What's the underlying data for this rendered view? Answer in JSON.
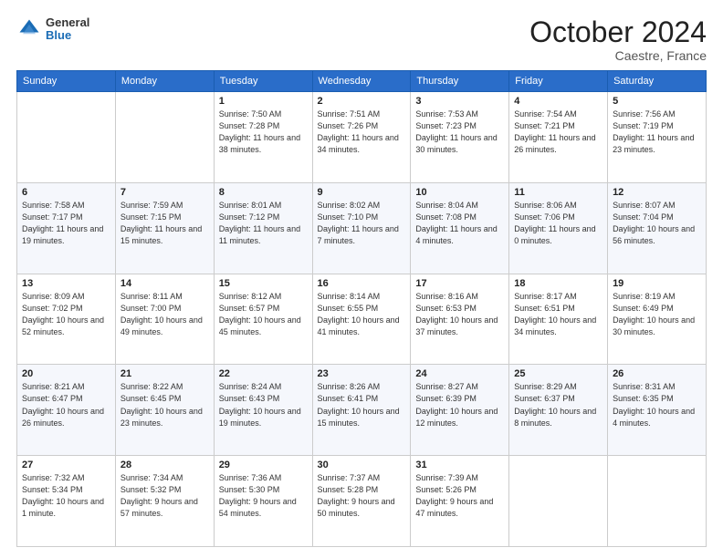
{
  "header": {
    "logo_general": "General",
    "logo_blue": "Blue",
    "month": "October 2024",
    "location": "Caestre, France"
  },
  "weekdays": [
    "Sunday",
    "Monday",
    "Tuesday",
    "Wednesday",
    "Thursday",
    "Friday",
    "Saturday"
  ],
  "weeks": [
    [
      {
        "day": "",
        "sunrise": "",
        "sunset": "",
        "daylight": ""
      },
      {
        "day": "",
        "sunrise": "",
        "sunset": "",
        "daylight": ""
      },
      {
        "day": "1",
        "sunrise": "Sunrise: 7:50 AM",
        "sunset": "Sunset: 7:28 PM",
        "daylight": "Daylight: 11 hours and 38 minutes."
      },
      {
        "day": "2",
        "sunrise": "Sunrise: 7:51 AM",
        "sunset": "Sunset: 7:26 PM",
        "daylight": "Daylight: 11 hours and 34 minutes."
      },
      {
        "day": "3",
        "sunrise": "Sunrise: 7:53 AM",
        "sunset": "Sunset: 7:23 PM",
        "daylight": "Daylight: 11 hours and 30 minutes."
      },
      {
        "day": "4",
        "sunrise": "Sunrise: 7:54 AM",
        "sunset": "Sunset: 7:21 PM",
        "daylight": "Daylight: 11 hours and 26 minutes."
      },
      {
        "day": "5",
        "sunrise": "Sunrise: 7:56 AM",
        "sunset": "Sunset: 7:19 PM",
        "daylight": "Daylight: 11 hours and 23 minutes."
      }
    ],
    [
      {
        "day": "6",
        "sunrise": "Sunrise: 7:58 AM",
        "sunset": "Sunset: 7:17 PM",
        "daylight": "Daylight: 11 hours and 19 minutes."
      },
      {
        "day": "7",
        "sunrise": "Sunrise: 7:59 AM",
        "sunset": "Sunset: 7:15 PM",
        "daylight": "Daylight: 11 hours and 15 minutes."
      },
      {
        "day": "8",
        "sunrise": "Sunrise: 8:01 AM",
        "sunset": "Sunset: 7:12 PM",
        "daylight": "Daylight: 11 hours and 11 minutes."
      },
      {
        "day": "9",
        "sunrise": "Sunrise: 8:02 AM",
        "sunset": "Sunset: 7:10 PM",
        "daylight": "Daylight: 11 hours and 7 minutes."
      },
      {
        "day": "10",
        "sunrise": "Sunrise: 8:04 AM",
        "sunset": "Sunset: 7:08 PM",
        "daylight": "Daylight: 11 hours and 4 minutes."
      },
      {
        "day": "11",
        "sunrise": "Sunrise: 8:06 AM",
        "sunset": "Sunset: 7:06 PM",
        "daylight": "Daylight: 11 hours and 0 minutes."
      },
      {
        "day": "12",
        "sunrise": "Sunrise: 8:07 AM",
        "sunset": "Sunset: 7:04 PM",
        "daylight": "Daylight: 10 hours and 56 minutes."
      }
    ],
    [
      {
        "day": "13",
        "sunrise": "Sunrise: 8:09 AM",
        "sunset": "Sunset: 7:02 PM",
        "daylight": "Daylight: 10 hours and 52 minutes."
      },
      {
        "day": "14",
        "sunrise": "Sunrise: 8:11 AM",
        "sunset": "Sunset: 7:00 PM",
        "daylight": "Daylight: 10 hours and 49 minutes."
      },
      {
        "day": "15",
        "sunrise": "Sunrise: 8:12 AM",
        "sunset": "Sunset: 6:57 PM",
        "daylight": "Daylight: 10 hours and 45 minutes."
      },
      {
        "day": "16",
        "sunrise": "Sunrise: 8:14 AM",
        "sunset": "Sunset: 6:55 PM",
        "daylight": "Daylight: 10 hours and 41 minutes."
      },
      {
        "day": "17",
        "sunrise": "Sunrise: 8:16 AM",
        "sunset": "Sunset: 6:53 PM",
        "daylight": "Daylight: 10 hours and 37 minutes."
      },
      {
        "day": "18",
        "sunrise": "Sunrise: 8:17 AM",
        "sunset": "Sunset: 6:51 PM",
        "daylight": "Daylight: 10 hours and 34 minutes."
      },
      {
        "day": "19",
        "sunrise": "Sunrise: 8:19 AM",
        "sunset": "Sunset: 6:49 PM",
        "daylight": "Daylight: 10 hours and 30 minutes."
      }
    ],
    [
      {
        "day": "20",
        "sunrise": "Sunrise: 8:21 AM",
        "sunset": "Sunset: 6:47 PM",
        "daylight": "Daylight: 10 hours and 26 minutes."
      },
      {
        "day": "21",
        "sunrise": "Sunrise: 8:22 AM",
        "sunset": "Sunset: 6:45 PM",
        "daylight": "Daylight: 10 hours and 23 minutes."
      },
      {
        "day": "22",
        "sunrise": "Sunrise: 8:24 AM",
        "sunset": "Sunset: 6:43 PM",
        "daylight": "Daylight: 10 hours and 19 minutes."
      },
      {
        "day": "23",
        "sunrise": "Sunrise: 8:26 AM",
        "sunset": "Sunset: 6:41 PM",
        "daylight": "Daylight: 10 hours and 15 minutes."
      },
      {
        "day": "24",
        "sunrise": "Sunrise: 8:27 AM",
        "sunset": "Sunset: 6:39 PM",
        "daylight": "Daylight: 10 hours and 12 minutes."
      },
      {
        "day": "25",
        "sunrise": "Sunrise: 8:29 AM",
        "sunset": "Sunset: 6:37 PM",
        "daylight": "Daylight: 10 hours and 8 minutes."
      },
      {
        "day": "26",
        "sunrise": "Sunrise: 8:31 AM",
        "sunset": "Sunset: 6:35 PM",
        "daylight": "Daylight: 10 hours and 4 minutes."
      }
    ],
    [
      {
        "day": "27",
        "sunrise": "Sunrise: 7:32 AM",
        "sunset": "Sunset: 5:34 PM",
        "daylight": "Daylight: 10 hours and 1 minute."
      },
      {
        "day": "28",
        "sunrise": "Sunrise: 7:34 AM",
        "sunset": "Sunset: 5:32 PM",
        "daylight": "Daylight: 9 hours and 57 minutes."
      },
      {
        "day": "29",
        "sunrise": "Sunrise: 7:36 AM",
        "sunset": "Sunset: 5:30 PM",
        "daylight": "Daylight: 9 hours and 54 minutes."
      },
      {
        "day": "30",
        "sunrise": "Sunrise: 7:37 AM",
        "sunset": "Sunset: 5:28 PM",
        "daylight": "Daylight: 9 hours and 50 minutes."
      },
      {
        "day": "31",
        "sunrise": "Sunrise: 7:39 AM",
        "sunset": "Sunset: 5:26 PM",
        "daylight": "Daylight: 9 hours and 47 minutes."
      },
      {
        "day": "",
        "sunrise": "",
        "sunset": "",
        "daylight": ""
      },
      {
        "day": "",
        "sunrise": "",
        "sunset": "",
        "daylight": ""
      }
    ]
  ]
}
